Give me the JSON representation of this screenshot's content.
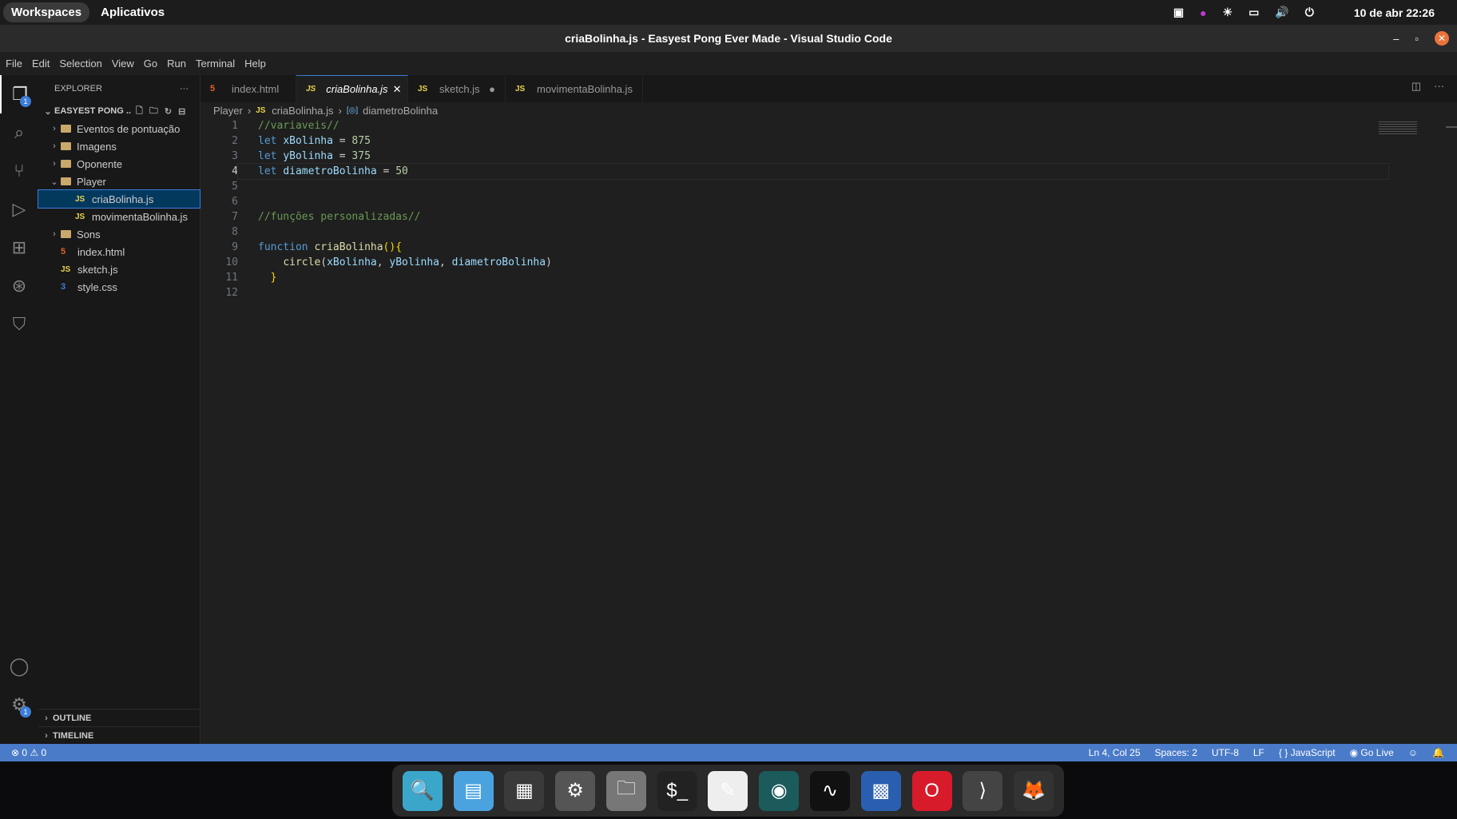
{
  "topbar": {
    "workspaces": "Workspaces",
    "apps": "Aplicativos",
    "datetime": "10 de abr  22:26"
  },
  "window": {
    "title": "criaBolinha.js - Easyest Pong Ever Made - Visual Studio Code"
  },
  "menu": [
    "File",
    "Edit",
    "Selection",
    "View",
    "Go",
    "Run",
    "Terminal",
    "Help"
  ],
  "activity": {
    "explorer_badge": "1",
    "settings_badge": "1"
  },
  "explorer": {
    "title": "EXPLORER",
    "more": "···",
    "project": "EASYEST PONG ...",
    "tree": [
      {
        "label": "Eventos de pontuação",
        "type": "folder",
        "depth": 0,
        "open": false
      },
      {
        "label": "Imagens",
        "type": "folder",
        "depth": 0,
        "open": false
      },
      {
        "label": "Oponente",
        "type": "folder",
        "depth": 0,
        "open": false
      },
      {
        "label": "Player",
        "type": "folder",
        "depth": 0,
        "open": true
      },
      {
        "label": "criaBolinha.js",
        "type": "js",
        "depth": 1,
        "selected": true
      },
      {
        "label": "movimentaBolinha.js",
        "type": "js",
        "depth": 1
      },
      {
        "label": "Sons",
        "type": "folder",
        "depth": 0,
        "open": false
      },
      {
        "label": "index.html",
        "type": "html",
        "depth": 0
      },
      {
        "label": "sketch.js",
        "type": "js",
        "depth": 0
      },
      {
        "label": "style.css",
        "type": "css",
        "depth": 0
      }
    ],
    "outline": "OUTLINE",
    "timeline": "TIMELINE"
  },
  "tabs": [
    {
      "label": "index.html",
      "type": "html"
    },
    {
      "label": "criaBolinha.js",
      "type": "js",
      "active": true
    },
    {
      "label": "sketch.js",
      "type": "js",
      "modified": true
    },
    {
      "label": "movimentaBolinha.js",
      "type": "js"
    }
  ],
  "breadcrumb": {
    "folder": "Player",
    "file": "criaBolinha.js",
    "symbol": "diametroBolinha"
  },
  "code": [
    "//variaveis//",
    "let xBolinha = 875",
    "let yBolinha = 375",
    "let diametroBolinha = 50",
    "",
    "",
    "//funções personalizadas//",
    "",
    "function criaBolinha(){",
    "    circle(xBolinha, yBolinha, diametroBolinha)",
    "  }",
    ""
  ],
  "current_line": 4,
  "status": {
    "errors": "⊗ 0 ⚠ 0",
    "position": "Ln 4, Col 25",
    "spaces": "Spaces: 2",
    "encoding": "UTF-8",
    "eol": "LF",
    "language": "{ } JavaScript",
    "golive": "Go Live"
  },
  "dock": [
    "search",
    "files-manager",
    "app-grid",
    "settings",
    "file-manager",
    "terminal",
    "text-editor",
    "monitor",
    "system-monitor",
    "checkerboard",
    "opera",
    "vscode",
    "firefox"
  ]
}
